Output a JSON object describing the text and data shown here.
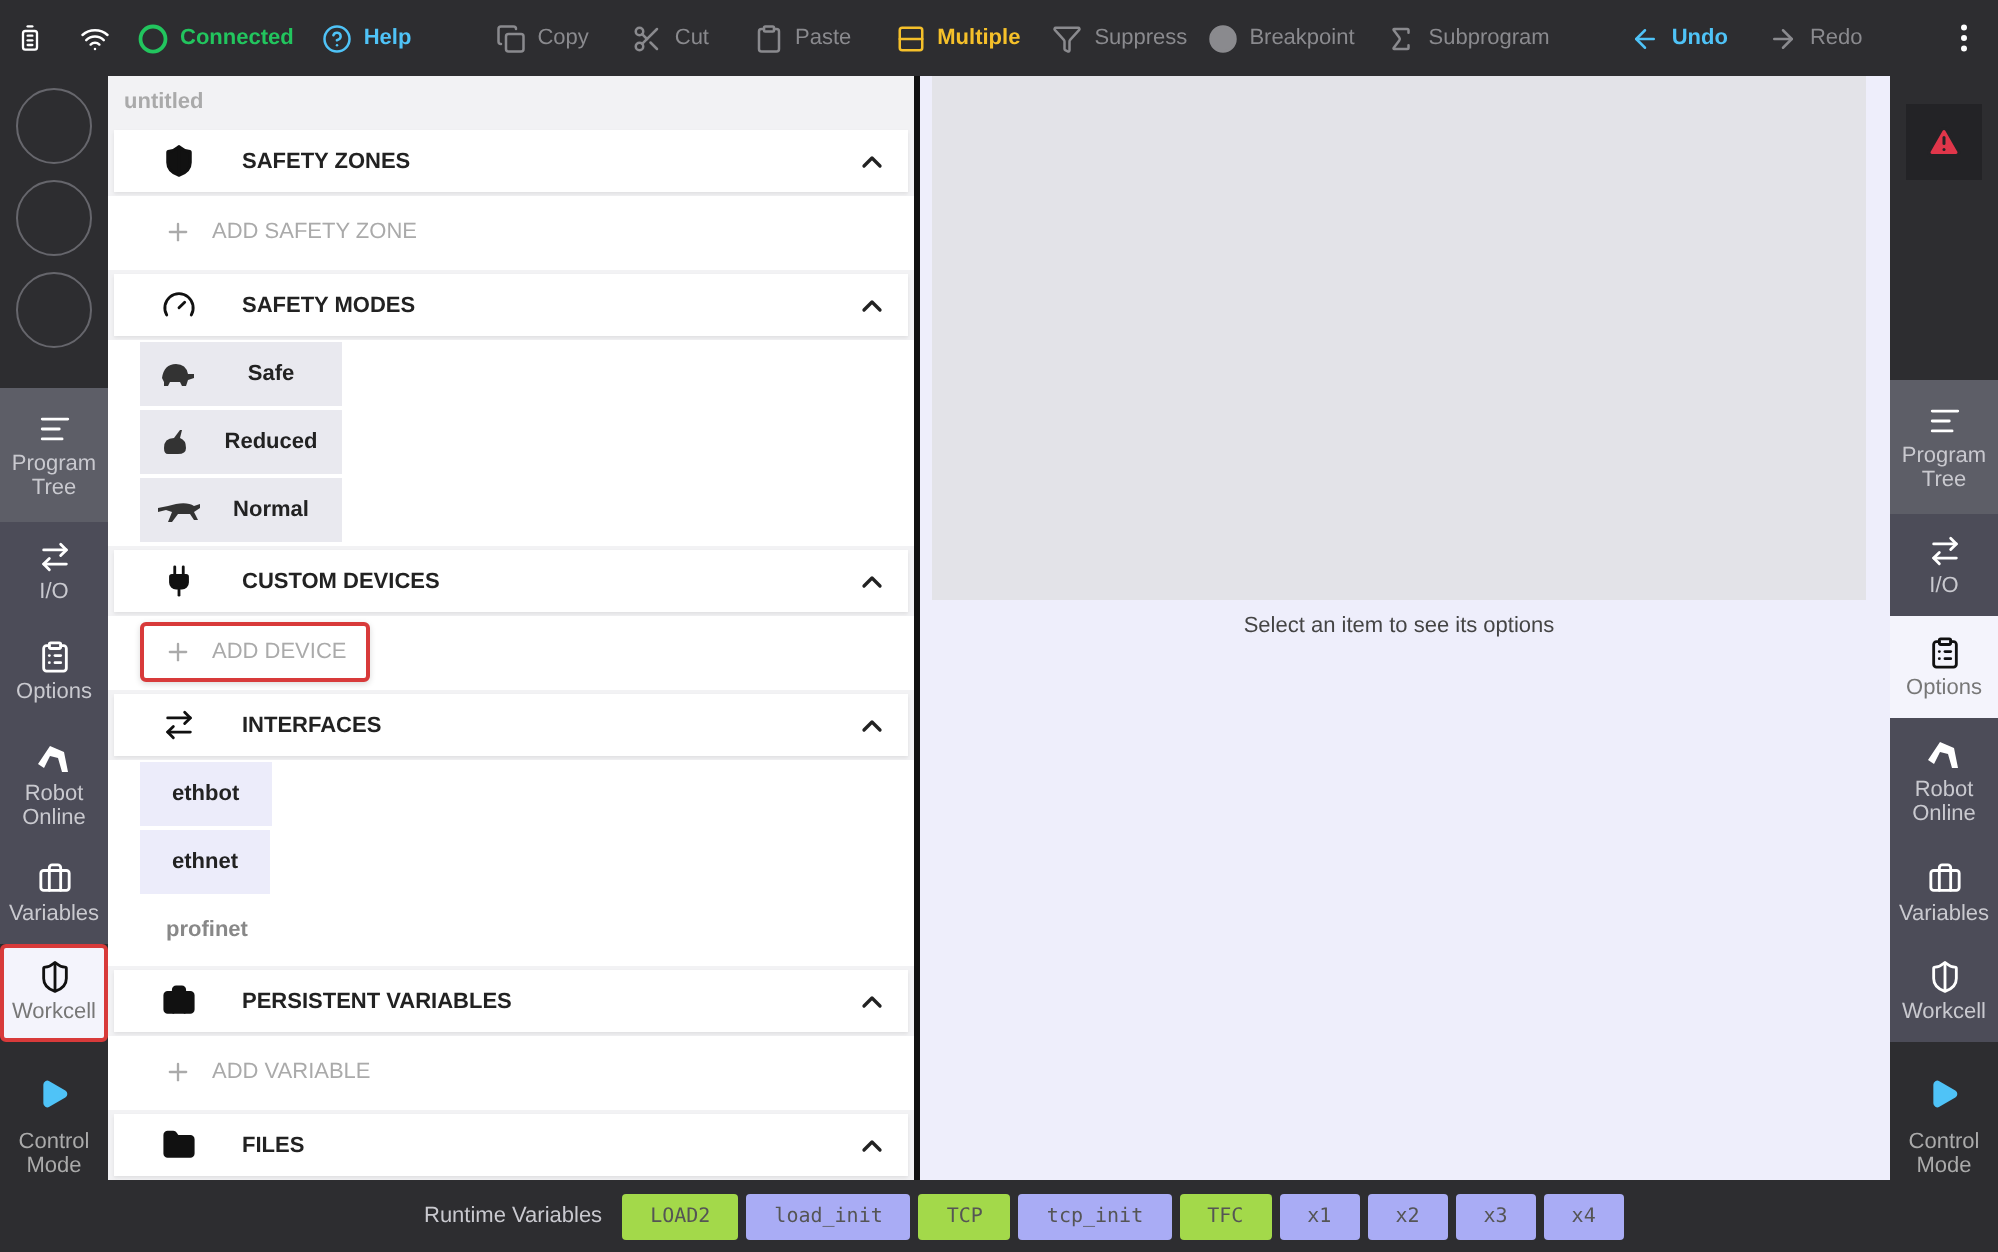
{
  "toolbar": {
    "items": [
      {
        "label": "Connected",
        "color": "#22c55e"
      },
      {
        "label": "Help",
        "color": "#4fc3f7"
      },
      {
        "label": "Copy",
        "color": "#8a8a8e"
      },
      {
        "label": "Cut",
        "color": "#8a8a8e"
      },
      {
        "label": "Paste",
        "color": "#8a8a8e"
      },
      {
        "label": "Multiple",
        "color": "#f5c02a"
      },
      {
        "label": "Suppress",
        "color": "#8a8a8e"
      },
      {
        "label": "Breakpoint",
        "color": "#8a8a8e"
      },
      {
        "label": "Subprogram",
        "color": "#8a8a8e"
      },
      {
        "label": "Undo",
        "color": "#4fc3f7"
      },
      {
        "label": "Redo",
        "color": "#8a8a8e"
      }
    ]
  },
  "left_rail": {
    "items": [
      {
        "label": "Program Tree",
        "selected": false,
        "highlighted": false
      },
      {
        "label": "I/O",
        "selected": false,
        "highlighted": false
      },
      {
        "label": "Options",
        "selected": false,
        "highlighted": false
      },
      {
        "label": "Robot Online",
        "selected": false,
        "highlighted": false
      },
      {
        "label": "Variables",
        "selected": false,
        "highlighted": false
      },
      {
        "label": "Workcell",
        "selected": true,
        "highlighted": true
      }
    ],
    "control": "Control Mode"
  },
  "workcell": {
    "title": "untitled",
    "sections": [
      {
        "title": "SAFETY ZONES",
        "expanded": true,
        "items": [
          {
            "kind": "add",
            "label": "ADD SAFETY ZONE",
            "highlighted": false
          }
        ]
      },
      {
        "title": "SAFETY MODES",
        "expanded": true,
        "items": [
          {
            "kind": "mode",
            "label": "Safe"
          },
          {
            "kind": "mode",
            "label": "Reduced"
          },
          {
            "kind": "mode",
            "label": "Normal"
          }
        ]
      },
      {
        "title": "CUSTOM DEVICES",
        "expanded": true,
        "items": [
          {
            "kind": "add",
            "label": "ADD DEVICE",
            "highlighted": true
          }
        ]
      },
      {
        "title": "INTERFACES",
        "expanded": true,
        "items": [
          {
            "kind": "interface",
            "label": "ethbot"
          },
          {
            "kind": "interface",
            "label": "ethnet"
          },
          {
            "kind": "plain",
            "label": "profinet"
          }
        ]
      },
      {
        "title": "PERSISTENT VARIABLES",
        "expanded": true,
        "items": [
          {
            "kind": "add",
            "label": "ADD VARIABLE",
            "highlighted": false
          }
        ]
      },
      {
        "title": "FILES",
        "expanded": true
      }
    ]
  },
  "options_panel": {
    "message": "Select an item to see its options"
  },
  "right_rail": {
    "items": [
      {
        "label": "Program Tree",
        "selected": false
      },
      {
        "label": "I/O",
        "selected": false
      },
      {
        "label": "Options",
        "selected": true
      },
      {
        "label": "Robot Online",
        "selected": false
      },
      {
        "label": "Variables",
        "selected": false
      },
      {
        "label": "Workcell",
        "selected": false
      }
    ],
    "control": "Control Mode"
  },
  "runtime_variables": {
    "label": "Runtime Variables",
    "chips": [
      {
        "label": "LOAD2",
        "color": "#a3d94a"
      },
      {
        "label": "load_init",
        "color": "#a9acf5"
      },
      {
        "label": "TCP",
        "color": "#a3d94a"
      },
      {
        "label": "tcp_init",
        "color": "#a9acf5"
      },
      {
        "label": "TFC",
        "color": "#a3d94a"
      },
      {
        "label": "x1",
        "color": "#a9acf5"
      },
      {
        "label": "x2",
        "color": "#a9acf5"
      },
      {
        "label": "x3",
        "color": "#a9acf5"
      },
      {
        "label": "x4",
        "color": "#a9acf5"
      }
    ]
  }
}
